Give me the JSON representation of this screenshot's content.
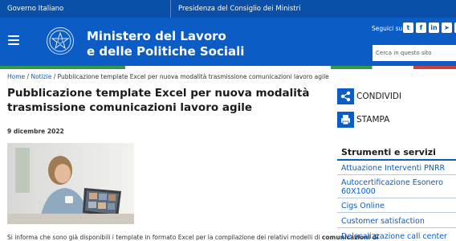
{
  "topbar": {
    "gov_link": "Governo Italiano",
    "presidency_link": "Presidenza del Consiglio dei Ministri"
  },
  "header": {
    "title_line1": "Ministero del Lavoro",
    "title_line2": "e delle Politiche Sociali",
    "follow_label": "Seguici su:",
    "socials": [
      {
        "icon": "twitter-icon",
        "glyph": "t"
      },
      {
        "icon": "facebook-icon",
        "glyph": "f"
      },
      {
        "icon": "linkedin-icon",
        "glyph": "in"
      },
      {
        "icon": "telegram-icon",
        "glyph": "➤"
      },
      {
        "icon": "youtube-icon",
        "glyph": "▶"
      }
    ],
    "search_placeholder": "Cerca in questo sito",
    "bar_color": "#0b5cc5"
  },
  "tricolor": {
    "green": "#2e9a45",
    "white": "#ffffff",
    "red": "#d23b3b"
  },
  "breadcrumb": {
    "home": "Home",
    "news": "Notizie",
    "current": "Pubblicazione template Excel per nuova modalità trasmissione comunicazioni lavoro agile"
  },
  "article": {
    "title": "Pubblicazione template Excel per nuova modalità trasmissione comunicazioni lavoro agile",
    "date": "9 dicembre 2022",
    "intro_text": "Si informa che sono già disponibili i template in formato Excel per la compilazione dei relativi modelli di",
    "intro_bold": "comunicazioni di"
  },
  "actions": {
    "share_label": "CONDIVIDI",
    "print_label": "STAMPA"
  },
  "sidebar": {
    "title": "Strumenti e servizi",
    "items": [
      {
        "label": "Attuazione Interventi PNRR"
      },
      {
        "label": "Autocertificazione Esonero 60X1000"
      },
      {
        "label": "Cigs Online"
      },
      {
        "label": "Customer satisfaction"
      },
      {
        "label": "Delocalizzazione call center"
      }
    ]
  }
}
